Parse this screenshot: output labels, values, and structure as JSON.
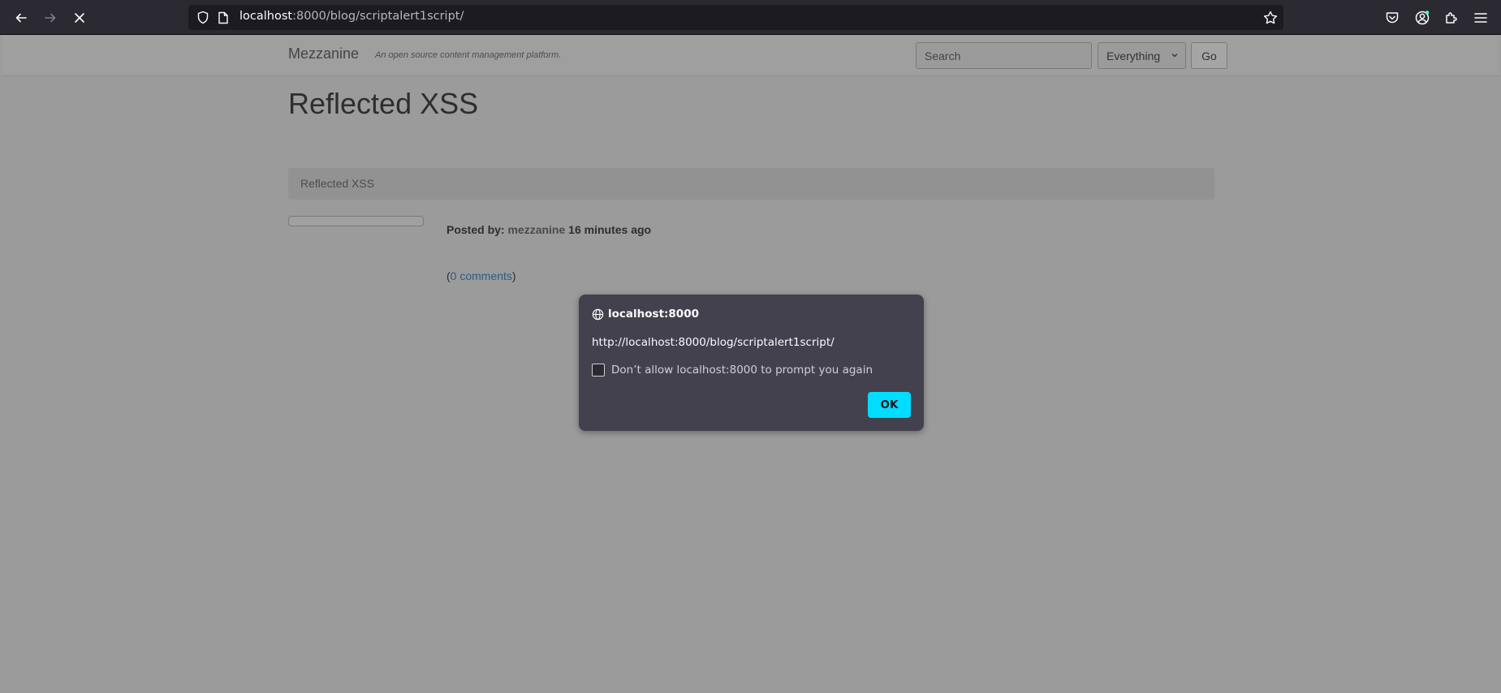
{
  "browser": {
    "url_host": "localhost",
    "url_rest": ":8000/blog/scriptalert1script/"
  },
  "site": {
    "brand": "Mezzanine",
    "tagline": "An open source content management platform.",
    "search_placeholder": "Search",
    "search_scope": "Everything",
    "go_label": "Go"
  },
  "page": {
    "title": "Reflected XSS",
    "breadcrumb": "Reflected XSS",
    "posted_by_label": "Posted by:",
    "author": "mezzanine",
    "time_ago": "16 minutes ago",
    "comments_open": "(",
    "comments_link": "0 comments",
    "comments_close": ")"
  },
  "dialog": {
    "origin": "localhost:8000",
    "message": "http://localhost:8000/blog/scriptalert1script/",
    "checkbox_label": "Don’t allow localhost:8000 to prompt you again",
    "ok_label": "OK"
  },
  "colors": {
    "chrome_bg": "#2b2a33",
    "dialog_bg": "#42414d",
    "ok_button": "#00ddff"
  }
}
